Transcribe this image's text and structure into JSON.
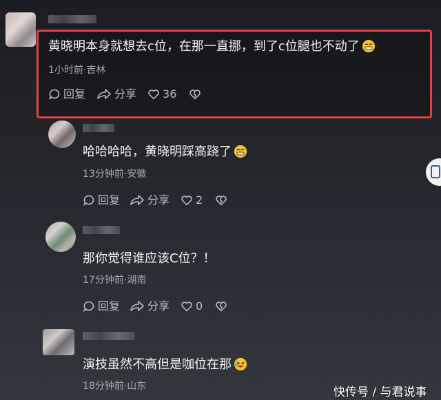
{
  "comments": [
    {
      "text": "黄晓明本身就想去c位，在那一直挪，到了c位腿也不动了",
      "meta": "1小时前·吉林",
      "reply": "回复",
      "share": "分享",
      "likes": "36"
    },
    {
      "text": "哈哈哈哈，黄晓明踩高跷了",
      "meta": "13分钟前·安徽",
      "reply": "回复",
      "share": "分享",
      "likes": "2"
    },
    {
      "text": "那你觉得谁应该C位？！",
      "meta": "17分钟前·湖南",
      "reply": "回复",
      "share": "分享",
      "likes": "0"
    },
    {
      "text": "演技虽然不高但是咖位在那",
      "meta": "18分钟前·山东"
    }
  ],
  "watermark": "快传号 / 与君说事",
  "colors": {
    "highlight": "#e0443c",
    "background": "#1f2025"
  }
}
